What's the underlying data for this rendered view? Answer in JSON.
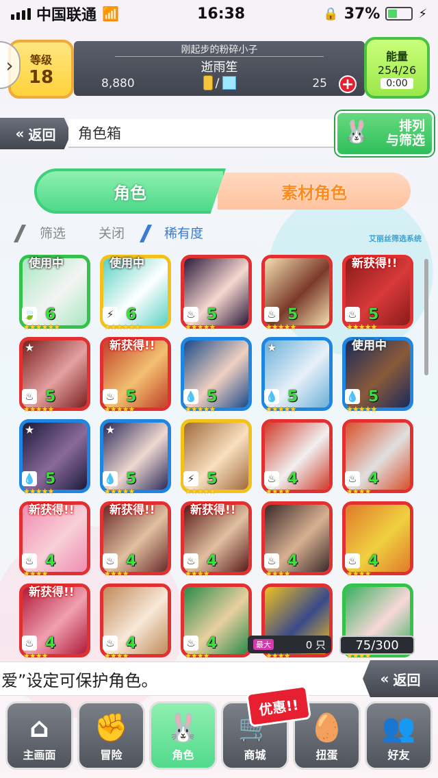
{
  "status_bar": {
    "carrier": "中国联通",
    "time": "16:38",
    "battery": "37%"
  },
  "header": {
    "level_label": "等级",
    "level_value": "18",
    "player_title": "刚起步的粉碎小子",
    "player_name": "逝雨笙",
    "coins": "8,880",
    "currency_sep": "/",
    "gems": "25",
    "energy_label": "能量",
    "energy_value": "254/26",
    "energy_timer": "0:00"
  },
  "nav_top": {
    "back_label": "返回",
    "page_title": "角色箱",
    "sort_label_1": "排列",
    "sort_label_2": "与筛选"
  },
  "tabs": [
    {
      "label": "角色",
      "active": true
    },
    {
      "label": "素材角色",
      "active": false
    }
  ],
  "filter": {
    "label": "筛选",
    "value": "关闭",
    "rarity": "稀有度",
    "system": "艾丽丝筛选系统"
  },
  "cards": [
    {
      "badge": "使用中",
      "badge_kind": "inuse",
      "level": "6",
      "stars": "★★★★★★",
      "frame": "#35c24a",
      "element": "wind",
      "art": [
        "#a8e8c0",
        "#f4f4f4"
      ]
    },
    {
      "badge": "使用中",
      "badge_kind": "inuse",
      "level": "6",
      "stars": "★★★★★★",
      "frame": "#f3c21a",
      "element": "thunder",
      "art": [
        "#5ad1c4",
        "#ffffff"
      ]
    },
    {
      "badge": "",
      "badge_kind": "",
      "level": "5",
      "stars": "★★★★★",
      "frame": "#e23030",
      "element": "fire",
      "art": [
        "#2a1a3a",
        "#f7d8d0"
      ]
    },
    {
      "badge": "",
      "badge_kind": "",
      "level": "5",
      "stars": "★★★★★",
      "frame": "#e23030",
      "element": "fire",
      "art": [
        "#f4e0b0",
        "#7a3a2a"
      ]
    },
    {
      "badge": "新获得!!",
      "badge_kind": "new",
      "level": "5",
      "stars": "★★★★★",
      "frame": "#e23030",
      "element": "fire",
      "art": [
        "#8a1a1a",
        "#d83a3a"
      ]
    },
    {
      "badge": "",
      "badge_kind": "",
      "fav": true,
      "level": "5",
      "stars": "★★★★★",
      "frame": "#e23030",
      "element": "fire",
      "art": [
        "#7a2020",
        "#e4a0a0"
      ]
    },
    {
      "badge": "新获得!!",
      "badge_kind": "new",
      "level": "5",
      "stars": "★★★★★",
      "frame": "#e23030",
      "element": "fire",
      "art": [
        "#c0402a",
        "#f2c070"
      ]
    },
    {
      "badge": "",
      "badge_kind": "",
      "level": "5",
      "stars": "★★★★★",
      "frame": "#1e86e0",
      "element": "water",
      "art": [
        "#1a4a8a",
        "#f0d0c0"
      ]
    },
    {
      "badge": "",
      "badge_kind": "",
      "fav": true,
      "level": "5",
      "stars": "★★★★★",
      "frame": "#1e86e0",
      "element": "water",
      "art": [
        "#6ab0d8",
        "#e8f0f8"
      ]
    },
    {
      "badge": "使用中",
      "badge_kind": "inuse",
      "level": "5",
      "stars": "★★★★★",
      "frame": "#1e86e0",
      "element": "water",
      "art": [
        "#1a2a5a",
        "#8a5a3a"
      ]
    },
    {
      "badge": "",
      "badge_kind": "",
      "fav": true,
      "level": "5",
      "stars": "★★★★★",
      "frame": "#1e86e0",
      "element": "water",
      "art": [
        "#1a1a3a",
        "#8a6a9a"
      ]
    },
    {
      "badge": "",
      "badge_kind": "",
      "fav": true,
      "level": "5",
      "stars": "★★★★★",
      "frame": "#1e86e0",
      "element": "water",
      "art": [
        "#2a2a5a",
        "#f0d8d0"
      ]
    },
    {
      "badge": "",
      "badge_kind": "",
      "level": "5",
      "stars": "★★★★★",
      "frame": "#f3c21a",
      "element": "thunder",
      "art": [
        "#a06a3a",
        "#f8e0c0"
      ]
    },
    {
      "badge": "",
      "badge_kind": "",
      "level": "4",
      "stars": "★★★★",
      "frame": "#e23030",
      "element": "fire",
      "art": [
        "#d03a2a",
        "#f0f0f0"
      ]
    },
    {
      "badge": "",
      "badge_kind": "",
      "level": "4",
      "stars": "★★★★",
      "frame": "#e23030",
      "element": "fire",
      "art": [
        "#d8502a",
        "#e0e0e0"
      ]
    },
    {
      "badge": "新获得!!",
      "badge_kind": "new",
      "level": "4",
      "stars": "★★★★",
      "frame": "#e23030",
      "element": "fire",
      "art": [
        "#f08ab0",
        "#f8d0d8"
      ]
    },
    {
      "badge": "新获得!!",
      "badge_kind": "new",
      "level": "4",
      "stars": "★★★★",
      "frame": "#e23030",
      "element": "fire",
      "art": [
        "#6a2a2a",
        "#e0c0a0"
      ]
    },
    {
      "badge": "新获得!!",
      "badge_kind": "new",
      "level": "4",
      "stars": "★★★★",
      "frame": "#e23030",
      "element": "fire",
      "art": [
        "#5a1a1a",
        "#e0c0a0"
      ]
    },
    {
      "badge": "",
      "badge_kind": "",
      "level": "4",
      "stars": "★★★★",
      "frame": "#e23030",
      "element": "fire",
      "art": [
        "#3a2a2a",
        "#d8b090"
      ]
    },
    {
      "badge": "",
      "badge_kind": "",
      "level": "4",
      "stars": "★★★★",
      "frame": "#e23030",
      "element": "fire",
      "art": [
        "#e07a2a",
        "#f0d040"
      ]
    },
    {
      "badge": "新获得!!",
      "badge_kind": "new",
      "level": "4",
      "stars": "★★★★",
      "frame": "#e23030",
      "element": "fire",
      "art": [
        "#b01a3a",
        "#f0a0b0"
      ]
    },
    {
      "badge": "",
      "badge_kind": "",
      "level": "4",
      "stars": "★★★★",
      "frame": "#e23030",
      "element": "fire",
      "art": [
        "#c08a5a",
        "#f8e8d8"
      ]
    },
    {
      "badge": "",
      "badge_kind": "",
      "level": "4",
      "stars": "★★★★",
      "frame": "#e23030",
      "element": "fire",
      "art": [
        "#2a8a4a",
        "#e8d0a0"
      ]
    },
    {
      "badge": "",
      "badge_kind": "",
      "level": "4",
      "stars": "★★★★",
      "frame": "#e23030",
      "element": "fire",
      "art": [
        "#f0c020",
        "#3a4a8a"
      ]
    },
    {
      "badge": "",
      "badge_kind": "",
      "level": "4",
      "stars": "★★★★",
      "frame": "#35c24a",
      "element": "wind",
      "art": [
        "#3ab060",
        "#f8d8d8"
      ]
    }
  ],
  "counters": {
    "fav_tag": "最大",
    "fav_count": "0 只",
    "box_count": "75/300"
  },
  "message": {
    "text": "爱”设定可保护角色。",
    "back_label": "返回"
  },
  "promo": "优惠!!",
  "bottom_nav": [
    {
      "label": "主画面",
      "icon": "home-icon",
      "active": false
    },
    {
      "label": "冒险",
      "icon": "handshake-icon",
      "active": false
    },
    {
      "label": "角色",
      "icon": "rabbit-icon",
      "active": true
    },
    {
      "label": "商城",
      "icon": "cart-icon",
      "active": false
    },
    {
      "label": "扭蛋",
      "icon": "egg-icon",
      "active": false
    },
    {
      "label": "好友",
      "icon": "friends-icon",
      "active": false
    }
  ]
}
